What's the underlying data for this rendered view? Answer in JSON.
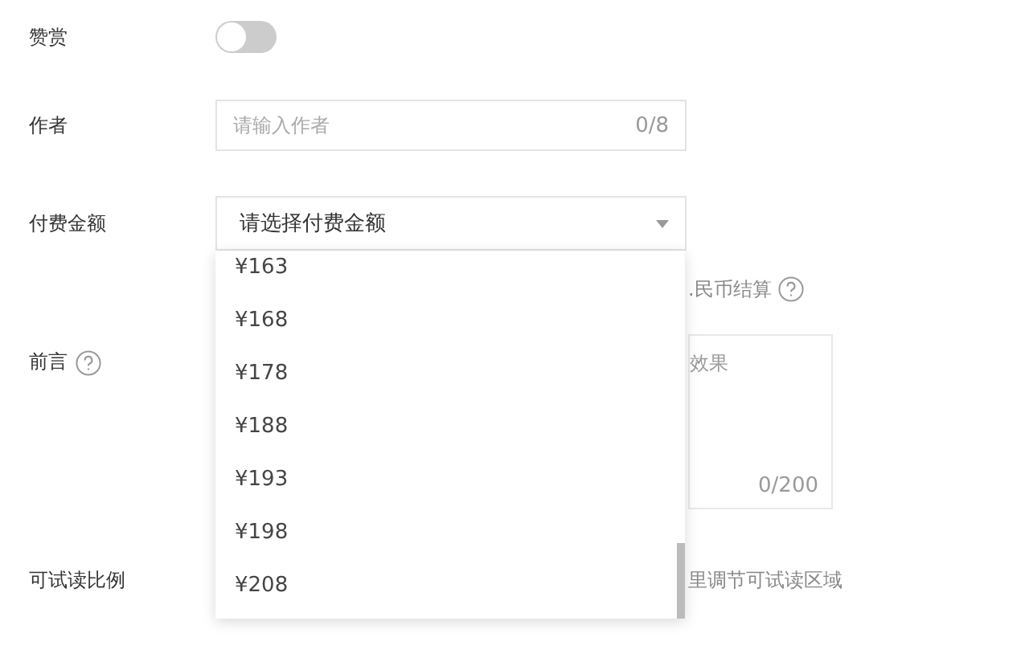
{
  "form": {
    "reward": {
      "label": "赞赏",
      "on": false
    },
    "author": {
      "label": "作者",
      "placeholder": "请输入作者",
      "count": "0/8"
    },
    "price": {
      "label": "付费金额",
      "placeholder": "请选择付费金额",
      "hint": ".民币结算"
    },
    "preface": {
      "label": "前言",
      "placeholder": "效果",
      "count": "0/200"
    },
    "trial": {
      "label": "可试读比例",
      "hint": "里调节可试读区域"
    }
  },
  "dropdown": {
    "options": [
      {
        "label": "¥163",
        "selected": false
      },
      {
        "label": "¥168",
        "selected": false
      },
      {
        "label": "¥178",
        "selected": false
      },
      {
        "label": "¥188",
        "selected": false
      },
      {
        "label": "¥193",
        "selected": false
      },
      {
        "label": "¥198",
        "selected": false
      },
      {
        "label": "¥208",
        "selected": false
      }
    ]
  }
}
